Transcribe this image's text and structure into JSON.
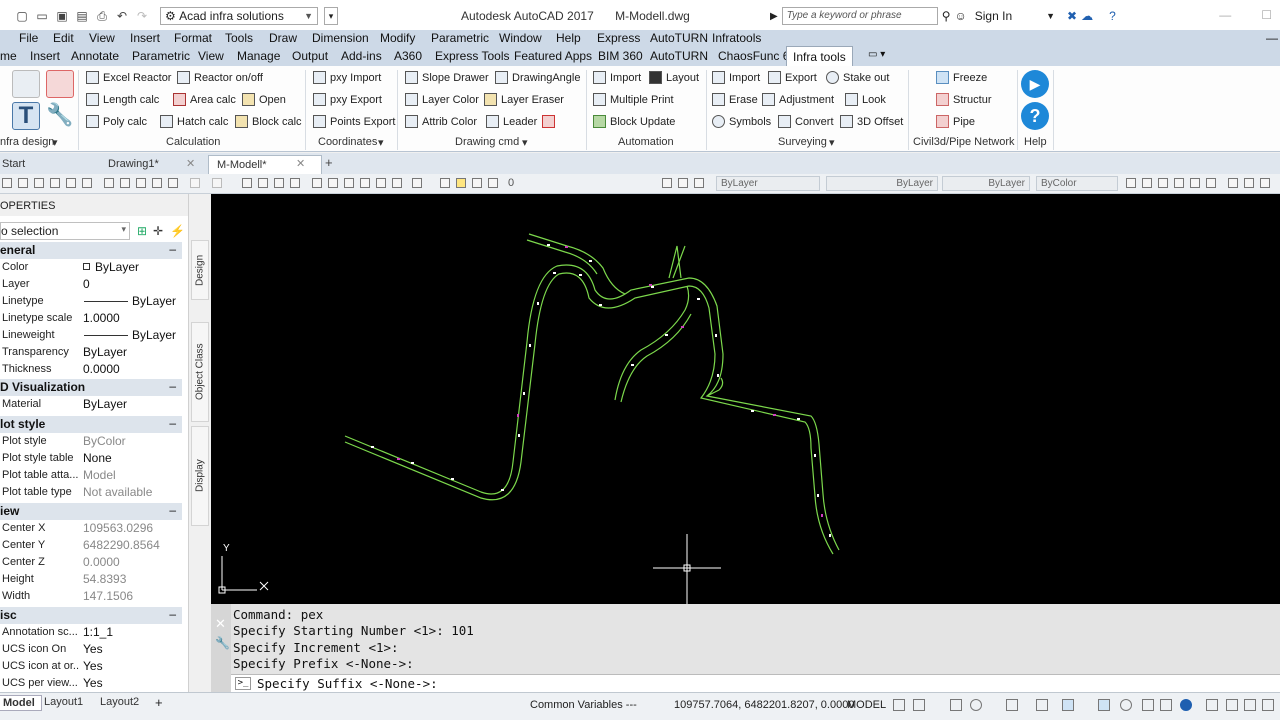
{
  "title_bar": {
    "workspace": "Acad infra solutions",
    "app_name": "Autodesk AutoCAD 2017",
    "file_name": "M-Modell.dwg",
    "search_placeholder": "Type a keyword or phrase",
    "sign_in": "Sign In"
  },
  "menu": [
    "File",
    "Edit",
    "View",
    "Insert",
    "Format",
    "Tools",
    "Draw",
    "Dimension",
    "Modify",
    "Parametric",
    "Window",
    "Help",
    "Express",
    "AutoTURN",
    "Infratools"
  ],
  "ribbon_tabs": [
    "me",
    "Insert",
    "Annotate",
    "Parametric",
    "View",
    "Manage",
    "Output",
    "Add-ins",
    "A360",
    "Express Tools",
    "Featured Apps",
    "BIM 360",
    "AutoTURN",
    "ChaosFunc 6",
    "Infra tools"
  ],
  "ribbon": {
    "calculation": [
      "Excel Reactor",
      "Reactor on/off",
      "Length calc",
      "Area calc",
      "Open",
      "Poly calc",
      "Hatch calc",
      "Block calc"
    ],
    "coordinates": [
      "pxy Import",
      "pxy Export",
      "Points Export"
    ],
    "drawing_cmd": [
      "Slope Drawer",
      "DrawingAngle",
      "Layer Color",
      "Layer Eraser",
      "Attrib Color",
      "Leader"
    ],
    "automation": [
      "Import",
      "Layout",
      "Multiple Print",
      "Block Update"
    ],
    "surveying": [
      "Import",
      "Export",
      "Stake out",
      "Erase",
      "Adjustment",
      "Look",
      "Symbols",
      "Convert",
      "3D Offset"
    ],
    "civil3d": [
      "Freeze",
      "Structur",
      "Pipe"
    ],
    "panel_titles": {
      "infra_design": "nfra design",
      "calculation": "Calculation",
      "coordinates": "Coordinates",
      "drawing_cmd": "Drawing cmd",
      "automation": "Automation",
      "surveying": "Surveying",
      "civil3d": "Civil3d/Pipe Network",
      "help": "Help"
    }
  },
  "file_tabs": [
    "Start",
    "Drawing1*",
    "M-Modell*"
  ],
  "toolbar": {
    "layer_value": "0",
    "color": "ByLayer",
    "linetype": "ByLayer",
    "lineweight": "ByLayer",
    "plotstyle": "ByColor"
  },
  "properties": {
    "title": "OPERTIES",
    "selection": "o selection",
    "sections": {
      "general": "eneral",
      "visualization": "D Visualization",
      "plot_style": "lot style",
      "view": "iew",
      "misc": "isc"
    },
    "general": [
      {
        "k": "Color",
        "v": "ByLayer"
      },
      {
        "k": "Layer",
        "v": "0"
      },
      {
        "k": "Linetype",
        "v": "ByLayer"
      },
      {
        "k": "Linetype scale",
        "v": "1.0000"
      },
      {
        "k": "Lineweight",
        "v": "ByLayer"
      },
      {
        "k": "Transparency",
        "v": "ByLayer"
      },
      {
        "k": "Thickness",
        "v": "0.0000"
      }
    ],
    "visualization": [
      {
        "k": "Material",
        "v": "ByLayer"
      }
    ],
    "plot_style": [
      {
        "k": "Plot style",
        "v": "ByColor"
      },
      {
        "k": "Plot style table",
        "v": "None"
      },
      {
        "k": "Plot table atta...",
        "v": "Model"
      },
      {
        "k": "Plot table type",
        "v": "Not available"
      }
    ],
    "view": [
      {
        "k": "Center X",
        "v": "109563.0296"
      },
      {
        "k": "Center Y",
        "v": "6482290.8564"
      },
      {
        "k": "Center Z",
        "v": "0.0000"
      },
      {
        "k": "Height",
        "v": "54.8393"
      },
      {
        "k": "Width",
        "v": "147.1506"
      }
    ],
    "misc": [
      {
        "k": "Annotation sc...",
        "v": "1:1_1"
      },
      {
        "k": "UCS icon On",
        "v": "Yes"
      },
      {
        "k": "UCS icon at or...",
        "v": "Yes"
      },
      {
        "k": "UCS per view...",
        "v": "Yes"
      }
    ]
  },
  "side_tabs": [
    "Design",
    "Object Class",
    "Display"
  ],
  "ucs": {
    "x": "X",
    "y": "Y"
  },
  "command": {
    "history": [
      "Command: pex",
      "Specify Starting Number <1>: 101",
      "Specify Increment <1>:",
      "Specify Prefix <-None->:"
    ],
    "prompt": "Specify Suffix <-None->:"
  },
  "status": {
    "layout_tabs": [
      "Model",
      "Layout1",
      "Layout2"
    ],
    "common_vars": "Common Variables ---",
    "coords": "109757.7064, 6482201.8207, 0.0000",
    "mode": "MODEL"
  },
  "colors": {
    "canvas": "#000000",
    "road_edge": "#7cd84c",
    "marker": "#ffffff"
  }
}
